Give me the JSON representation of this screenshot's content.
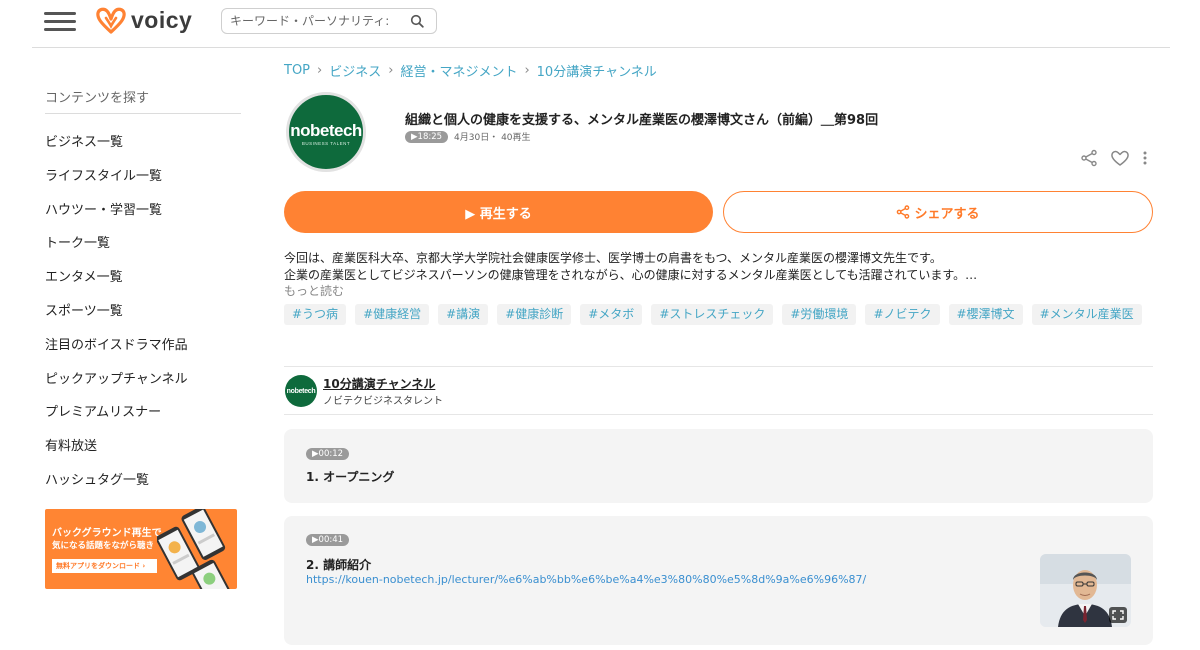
{
  "header": {
    "logo_text": "voicy",
    "search_placeholder": "キーワード・パーソナリティ:"
  },
  "sidebar": {
    "title": "コンテンツを探す",
    "items": [
      {
        "label": "ビジネス一覧"
      },
      {
        "label": "ライフスタイル一覧"
      },
      {
        "label": "ハウツー・学習一覧"
      },
      {
        "label": "トーク一覧"
      },
      {
        "label": "エンタメ一覧"
      },
      {
        "label": "スポーツ一覧"
      },
      {
        "label": "注目のボイスドラマ作品"
      },
      {
        "label": "ピックアップチャンネル"
      },
      {
        "label": "プレミアムリスナー"
      },
      {
        "label": "有料放送"
      },
      {
        "label": "ハッシュタグ一覧"
      }
    ],
    "banner": {
      "line1": "バックグラウンド再生で",
      "line2": "気になる話題をながら聴き",
      "button": "無料アプリをダウンロード ›"
    }
  },
  "breadcrumb": [
    "TOP",
    "ビジネス",
    "経営・マネジメント",
    "10分講演チャンネル"
  ],
  "episode": {
    "logo_text": "nobetech",
    "logo_sub": "BUSINESS TALENT",
    "title": "組織と個人の健康を支援する、メンタル産業医の櫻澤博文さん（前編）＿第98回",
    "duration": "▶18:25",
    "date_plays": "4月30日・ 40再生",
    "play_label": "▶ 再生する",
    "share_label": "シェアする",
    "description_line1": "今回は、産業医科大卒、京都大学大学院社会健康医学修士、医学博士の肩書をもつ、メンタル産業医の櫻澤博文先生です。",
    "description_line2": "企業の産業医としてビジネスパーソンの健康管理をされながら、心の健康に対するメンタル産業医としても活躍されています。…",
    "more_label": "もっと読む",
    "tags": [
      "#うつ病",
      "#健康経営",
      "#講演",
      "#健康診断",
      "#メタボ",
      "#ストレスチェック",
      "#労働環境",
      "#ノビテク",
      "#櫻澤博文",
      "#メンタル産業医"
    ]
  },
  "channel": {
    "logo_text": "nobetech",
    "name": "10分講演チャンネル",
    "owner": "ノビテクビジネスタレント"
  },
  "chapters": [
    {
      "time": "▶00:12",
      "title": "1. オープニング"
    },
    {
      "time": "▶00:41",
      "title": "2. 講師紹介",
      "link": "https://kouen-nobetech.jp/lecturer/%e6%ab%bb%e6%be%a4%e3%80%80%e5%8d%9a%e6%96%87/"
    }
  ],
  "colors": {
    "accent": "#ff8233",
    "link": "#45a6c5",
    "brand_green": "#0e6a3c"
  }
}
